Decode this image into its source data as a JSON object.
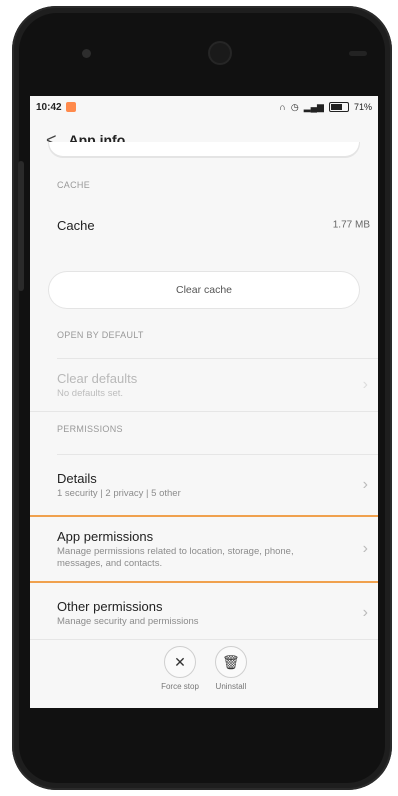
{
  "status": {
    "time": "10:42",
    "battery": "71%",
    "battery_level": 0.71
  },
  "appbar": {
    "title": "App info"
  },
  "cache": {
    "header": "CACHE",
    "label": "Cache",
    "value": "1.77 MB",
    "clear_button": "Clear cache"
  },
  "open_by_default": {
    "header": "OPEN BY DEFAULT",
    "title": "Clear defaults",
    "subtitle": "No defaults set."
  },
  "permissions": {
    "header": "PERMISSIONS",
    "details_title": "Details",
    "details_sub": "1 security | 2 privacy | 5 other",
    "app_title": "App permissions",
    "app_sub": "Manage permissions related to location, storage, phone, messages, and contacts.",
    "other_title": "Other permissions",
    "other_sub": "Manage security and permissions"
  },
  "actions": {
    "force_stop": "Force stop",
    "uninstall": "Uninstall"
  },
  "icons": {
    "back": "back-arrow-icon",
    "chevron": "chevron-right-icon",
    "close": "close-icon",
    "trash": "trash-icon"
  },
  "colors": {
    "highlight": "#f0a14e",
    "notification": "#ff8a4c"
  }
}
